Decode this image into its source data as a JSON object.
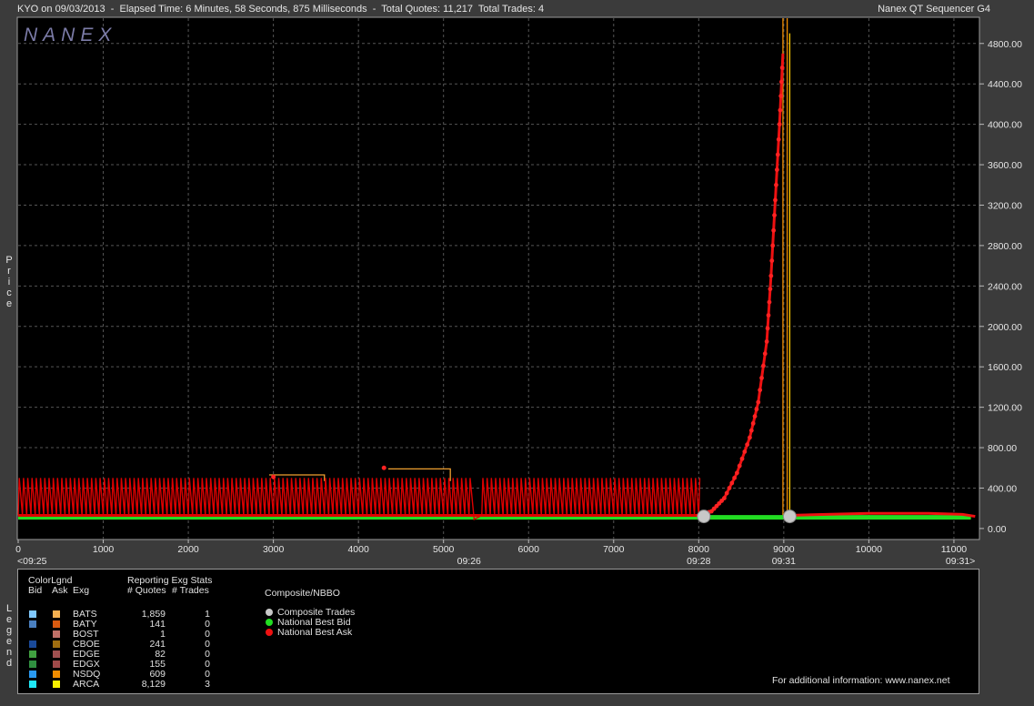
{
  "header": {
    "title": "KYO on 09/03/2013  -  Elapsed Time: 6 Minutes, 58 Seconds, 875 Milliseconds  -  Total Quotes: 11,217  Total Trades: 4",
    "app_name": "Nanex QT Sequencer G4",
    "watermark": "NANEX"
  },
  "axis_side_labels": {
    "price": "Price",
    "legend": "Legend"
  },
  "chart_data": {
    "type": "line",
    "xlim": [
      0,
      11300
    ],
    "ylim": [
      -100,
      5050
    ],
    "x_ticks": [
      0,
      1000,
      2000,
      3000,
      4000,
      5000,
      6000,
      7000,
      8000,
      9000,
      10000,
      11000
    ],
    "y_ticks": [
      0,
      400,
      800,
      1200,
      1600,
      2000,
      2400,
      2800,
      3200,
      3600,
      4000,
      4400,
      4800
    ],
    "y_tick_labels": [
      "0.00",
      "400.00",
      "800.00",
      "1200.00",
      "1600.00",
      "2000.00",
      "2400.00",
      "2800.00",
      "3200.00",
      "3600.00",
      "4000.00",
      "4400.00",
      "4800.00"
    ],
    "time_labels": [
      {
        "x": 0,
        "label": "<09:25"
      },
      {
        "x": 5300,
        "label": "09:26"
      },
      {
        "x": 8000,
        "label": "09:28"
      },
      {
        "x": 9000,
        "label": "09:31"
      },
      {
        "x": 11250,
        "label": "09:31>"
      }
    ],
    "grid": true,
    "series": [
      {
        "name": "National Best Bid",
        "color": "#22dd22",
        "points": [
          [
            0,
            110
          ],
          [
            2000,
            110
          ],
          [
            4000,
            110
          ],
          [
            6000,
            110
          ],
          [
            8000,
            110
          ],
          [
            9000,
            110
          ],
          [
            10000,
            110
          ],
          [
            11200,
            110
          ]
        ]
      },
      {
        "name": "National Best Ask",
        "color": "#ee1111",
        "low": 130,
        "high": 500,
        "oscillation_segments": [
          [
            0,
            5300
          ],
          [
            5450,
            8000
          ]
        ],
        "spikes": [
          [
            3000,
            510
          ],
          [
            4300,
            600
          ]
        ],
        "ramp": [
          [
            8000,
            130
          ],
          [
            8150,
            170
          ],
          [
            8300,
            300
          ],
          [
            8450,
            550
          ],
          [
            8600,
            900
          ],
          [
            8700,
            1250
          ],
          [
            8800,
            1850
          ],
          [
            8850,
            2500
          ],
          [
            8900,
            3250
          ],
          [
            8950,
            4000
          ],
          [
            8990,
            4700
          ]
        ],
        "after": [
          [
            9050,
            130
          ],
          [
            9500,
            140
          ],
          [
            10000,
            150
          ],
          [
            10300,
            150
          ],
          [
            10700,
            150
          ],
          [
            11100,
            140
          ],
          [
            11250,
            120
          ]
        ]
      },
      {
        "name": "Composite Trades",
        "color": "#c8c8c8",
        "points": [
          [
            8060,
            120
          ],
          [
            9070,
            120
          ]
        ]
      }
    ],
    "exchange_quote_lines": [
      {
        "name": "BATS",
        "color": "#f0a030",
        "points": [
          [
            2950,
            530
          ],
          [
            3600,
            530
          ],
          [
            3600,
            470
          ]
        ]
      },
      {
        "name": "BATS",
        "color": "#f0a030",
        "points": [
          [
            4350,
            590
          ],
          [
            5080,
            590
          ],
          [
            5080,
            470
          ]
        ]
      },
      {
        "name": "NSDQ",
        "color": "#f08c00",
        "points": [
          [
            8990,
            5050
          ],
          [
            8990,
            120
          ]
        ]
      },
      {
        "name": "NSDQ",
        "color": "#f08c00",
        "points": [
          [
            9040,
            5050
          ],
          [
            9040,
            120
          ]
        ]
      },
      {
        "name": "ARCA",
        "color": "#ffcc00",
        "points": [
          [
            9070,
            4900
          ],
          [
            9070,
            120
          ]
        ]
      }
    ]
  },
  "legend": {
    "color_legend_title": "ColorLgnd",
    "col_bid": "Bid",
    "col_ask": "Ask",
    "col_exg": "Exg",
    "stats_title": "Reporting Exg Stats",
    "col_quotes": "# Quotes",
    "col_trades": "# Trades",
    "rows": [
      {
        "exg": "BATS",
        "bid_color": "#7fc8ff",
        "ask_color": "#f5b050",
        "quotes": "1,859",
        "trades": "1"
      },
      {
        "exg": "BATY",
        "bid_color": "#4a80c0",
        "ask_color": "#d85a10",
        "quotes": "141",
        "trades": "0"
      },
      {
        "exg": "BOST",
        "bid_color": "#000000",
        "ask_color": "#c07068",
        "quotes": "1",
        "trades": "0"
      },
      {
        "exg": "CBOE",
        "bid_color": "#1a4a9a",
        "ask_color": "#a06e10",
        "quotes": "241",
        "trades": "0"
      },
      {
        "exg": "EDGE",
        "bid_color": "#40a040",
        "ask_color": "#a05050",
        "quotes": "82",
        "trades": "0"
      },
      {
        "exg": "EDGX",
        "bid_color": "#309040",
        "ask_color": "#a04a4a",
        "quotes": "155",
        "trades": "0"
      },
      {
        "exg": "NSDQ",
        "bid_color": "#2a9af0",
        "ask_color": "#f08c00",
        "quotes": "609",
        "trades": "0"
      },
      {
        "exg": "ARCA",
        "bid_color": "#20e8f8",
        "ask_color": "#f8f000",
        "quotes": "8,129",
        "trades": "3"
      }
    ],
    "composite_title": "Composite/NBBO",
    "composite_items": [
      {
        "label": "Composite Trades",
        "color": "#c8c8c8"
      },
      {
        "label": "National Best Bid",
        "color": "#22dd22"
      },
      {
        "label": "National Best Ask",
        "color": "#ee1111"
      }
    ],
    "footer": "For additional information: www.nanex.net"
  }
}
